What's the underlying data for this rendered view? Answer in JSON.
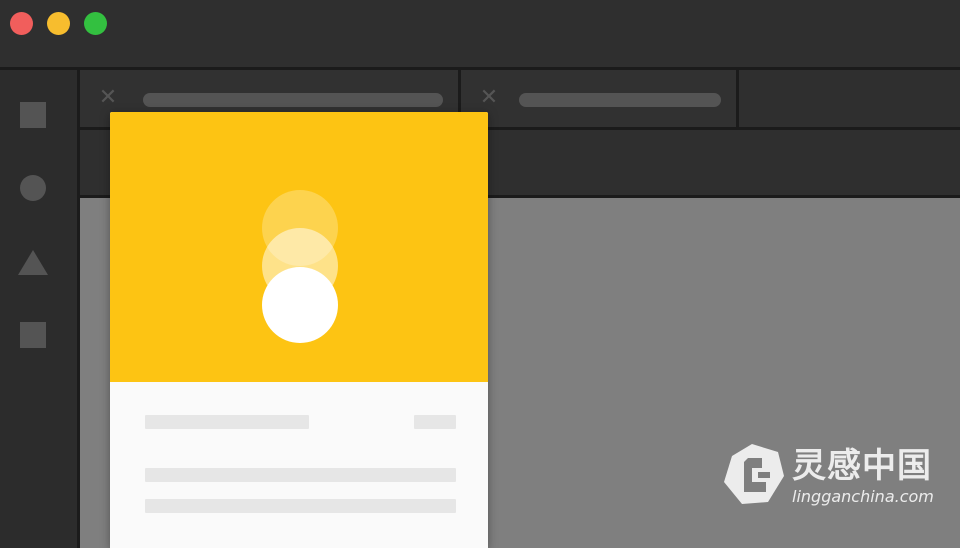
{
  "window": {
    "controls": [
      {
        "name": "close",
        "color": "#f15e5c"
      },
      {
        "name": "minimize",
        "color": "#f7bd2e"
      },
      {
        "name": "maximize",
        "color": "#33c040"
      }
    ]
  },
  "sidebar": {
    "tools": [
      "square-icon",
      "circle-icon",
      "triangle-icon",
      "square-icon"
    ],
    "icon_color": "#545454"
  },
  "tabs": [
    {
      "close_glyph": "✕",
      "icon": "close-icon"
    },
    {
      "close_glyph": "✕",
      "icon": "close-icon"
    }
  ],
  "card": {
    "header_color": "#fdc413",
    "body_color": "#fafafa",
    "placeholder_color": "#e6e6e6",
    "orbs": 3
  },
  "canvas": {
    "color": "#7f7f7f"
  },
  "watermark": {
    "title": "灵感中国",
    "subtitle": "lingganchina.com"
  }
}
